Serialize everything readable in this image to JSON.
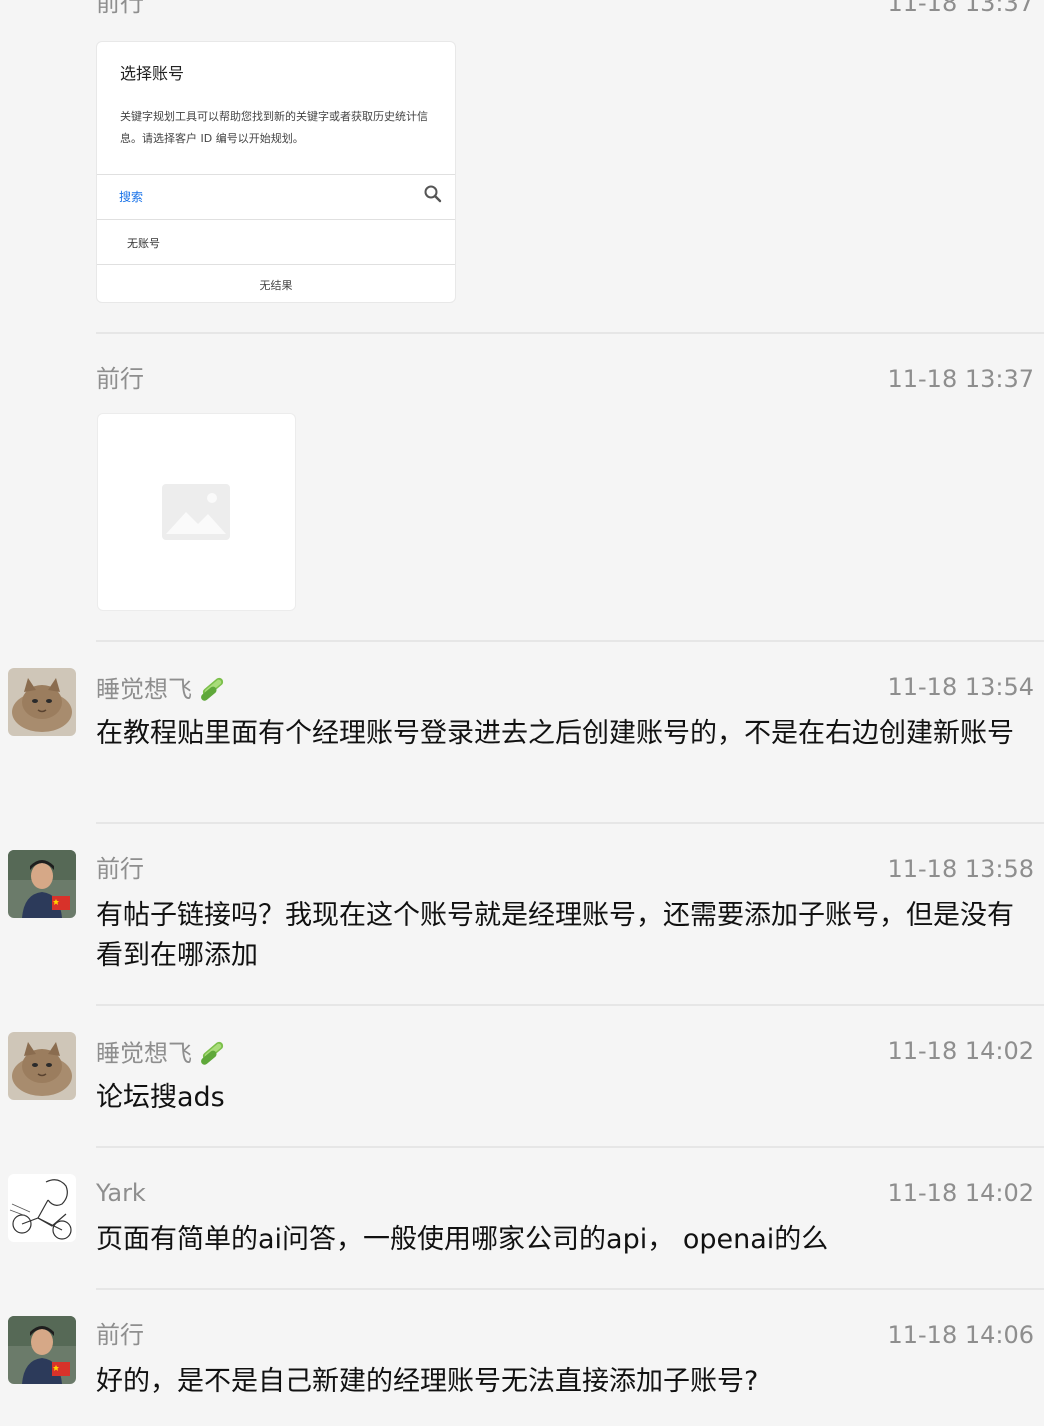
{
  "messages": [
    {
      "name": "前行",
      "time": "11-18 13:37",
      "attachment": {
        "type": "screenshot",
        "title": "选择账号",
        "description": "关键字规划工具可以帮助您找到新的关键字或者获取历史统计信息。请选择客户 ID 编号以开始规划。",
        "search_placeholder": "搜索",
        "item": "无账号",
        "empty_text": "无结果"
      }
    },
    {
      "name": "前行",
      "time": "11-18 13:37",
      "attachment": {
        "type": "image-placeholder"
      }
    },
    {
      "name": "睡觉想飞",
      "name_emoji": "cucumber-emoji",
      "time": "11-18 13:54",
      "text": "在教程贴里面有个经理账号登录进去之后创建账号的，不是在右边创建新账号",
      "avatar": "cat-avatar"
    },
    {
      "name": "前行",
      "time": "11-18 13:58",
      "text": "有帖子链接吗？我现在这个账号就是经理账号，还需要添加子账号，但是没有看到在哪添加",
      "avatar": "person-avatar"
    },
    {
      "name": "睡觉想飞",
      "name_emoji": "cucumber-emoji",
      "time": "11-18 14:02",
      "text": "论坛搜ads",
      "avatar": "cat-avatar"
    },
    {
      "name": "Yark",
      "time": "11-18 14:02",
      "text": "页面有简单的ai问答，一般使用哪家公司的api， openai的么",
      "avatar": "sketch-avatar"
    },
    {
      "name": "前行",
      "time": "11-18 14:06",
      "text": "好的，是不是自己新建的经理账号无法直接添加子账号?",
      "avatar": "person-avatar"
    }
  ],
  "colors": {
    "background": "#f5f5f5",
    "meta_text": "#8e8e8e",
    "body_text": "#111111",
    "divider": "#e6e6e6",
    "link_blue": "#1a73e8"
  }
}
